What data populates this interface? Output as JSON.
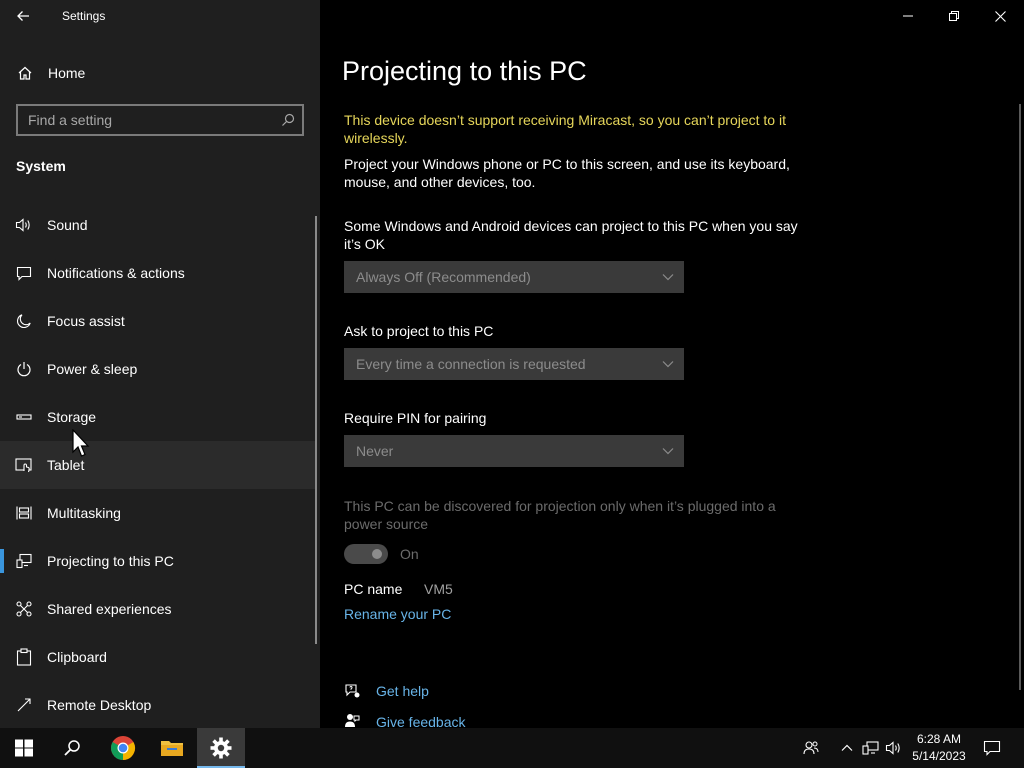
{
  "window": {
    "app_title": "Settings"
  },
  "sidebar": {
    "home_label": "Home",
    "search_placeholder": "Find a setting",
    "section_title": "System",
    "items": [
      {
        "label": "Sound",
        "icon": "speaker-icon"
      },
      {
        "label": "Notifications & actions",
        "icon": "notification-icon"
      },
      {
        "label": "Focus assist",
        "icon": "moon-icon"
      },
      {
        "label": "Power & sleep",
        "icon": "power-icon"
      },
      {
        "label": "Storage",
        "icon": "storage-icon"
      },
      {
        "label": "Tablet",
        "icon": "tablet-icon"
      },
      {
        "label": "Multitasking",
        "icon": "multitasking-icon"
      },
      {
        "label": "Projecting to this PC",
        "icon": "projecting-icon"
      },
      {
        "label": "Shared experiences",
        "icon": "shared-experiences-icon"
      },
      {
        "label": "Clipboard",
        "icon": "clipboard-icon"
      },
      {
        "label": "Remote Desktop",
        "icon": "remote-desktop-icon"
      }
    ]
  },
  "main": {
    "title": "Projecting to this PC",
    "warning": "This device doesn’t support receiving Miracast, so you can’t project to it wirelessly.",
    "intro": "Project your Windows phone or PC to this screen, and use its keyboard, mouse, and other devices, too.",
    "availability_label": "Some Windows and Android devices can project to this PC when you say it’s OK",
    "availability_value": "Always Off (Recommended)",
    "ask_label": "Ask to project to this PC",
    "ask_value": "Every time a connection is requested",
    "pin_label": "Require PIN for pairing",
    "pin_value": "Never",
    "power_note": "This PC can be discovered for projection only when it’s plugged into a power source",
    "toggle_state": "On",
    "pc_name_label": "PC name",
    "pc_name_value": "VM5",
    "rename_link": "Rename your PC",
    "get_help": "Get help",
    "give_feedback": "Give feedback"
  },
  "taskbar": {
    "time": "6:28 AM",
    "date": "5/14/2023"
  },
  "colors": {
    "accent": "#3a96dd",
    "link": "#68b4e8",
    "warning": "#e6d65a",
    "sidebar_bg": "#1f1f1f",
    "main_bg": "#000000"
  }
}
